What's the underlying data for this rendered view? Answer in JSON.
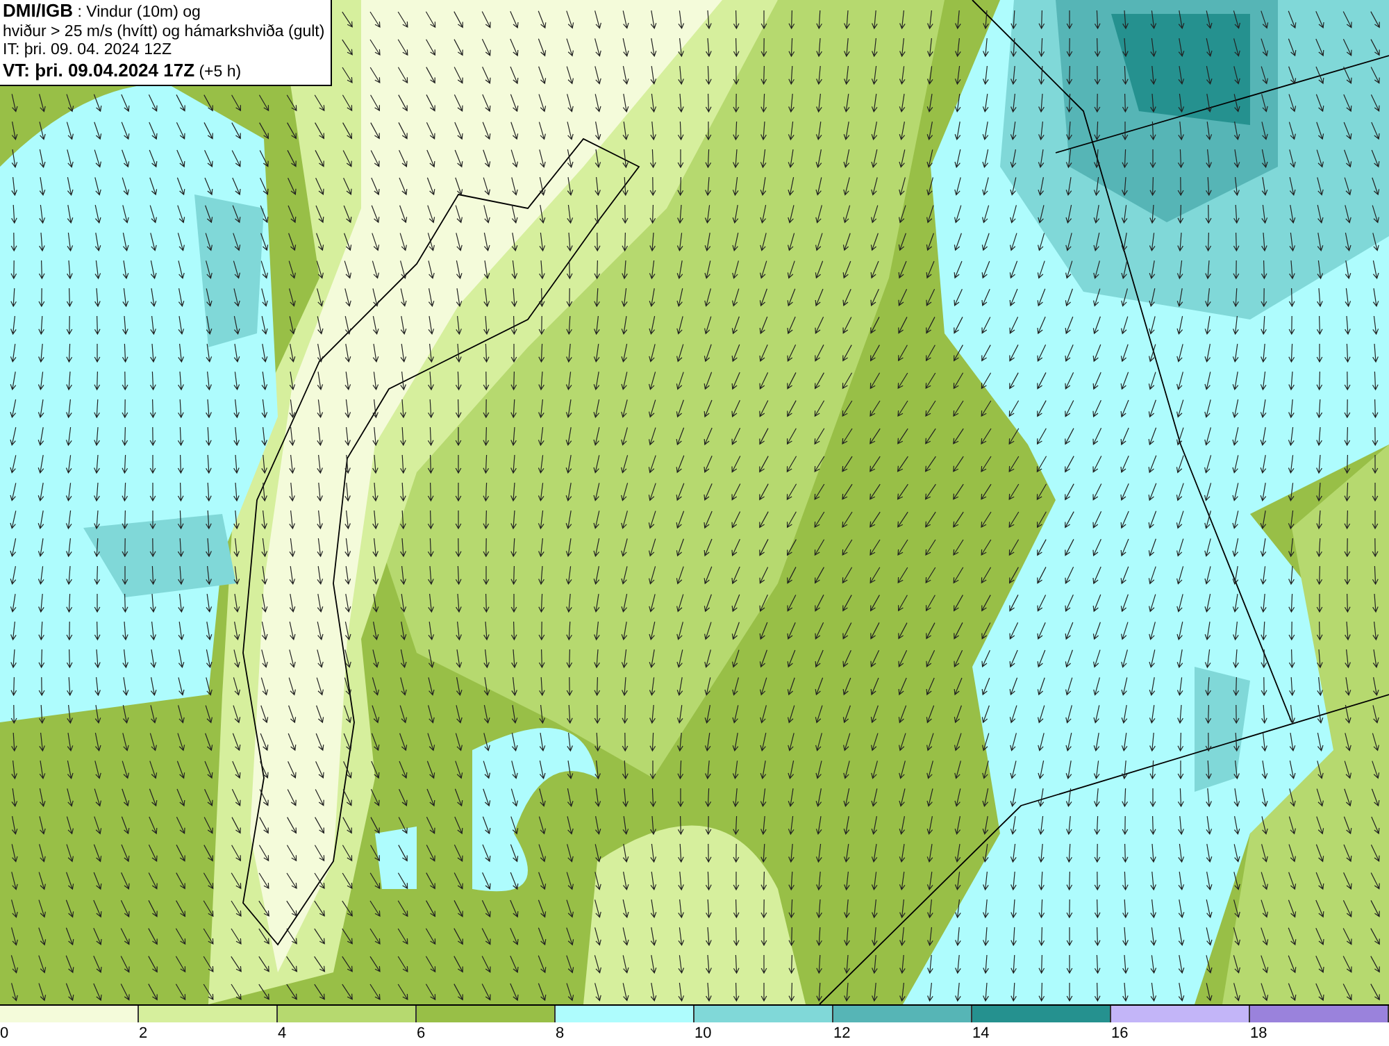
{
  "info_box": {
    "lines": [
      "**DMI/IGB** : Vindur (10m) og",
      "hviður > 25 m/s (hvítt) og hámarkshviða (gult)",
      "IT: þri. 09. 04. 2024 12Z",
      "**VT: þri. 09.04.2024 17Z** (+5 h)"
    ]
  },
  "legend": {
    "items": [
      {
        "label": "0",
        "color": "#f4fbda"
      },
      {
        "label": "2",
        "color": "#d6ef9d"
      },
      {
        "label": "4",
        "color": "#b6d96f"
      },
      {
        "label": "6",
        "color": "#98bf47"
      },
      {
        "label": "8",
        "color": "#aefcfd"
      },
      {
        "label": "10",
        "color": "#80d8d8"
      },
      {
        "label": "12",
        "color": "#56b5b6"
      },
      {
        "label": "14",
        "color": "#25918f"
      },
      {
        "label": "16",
        "color": "#c3b5f8"
      },
      {
        "label": "18",
        "color": "#9a82dc"
      }
    ]
  }
}
